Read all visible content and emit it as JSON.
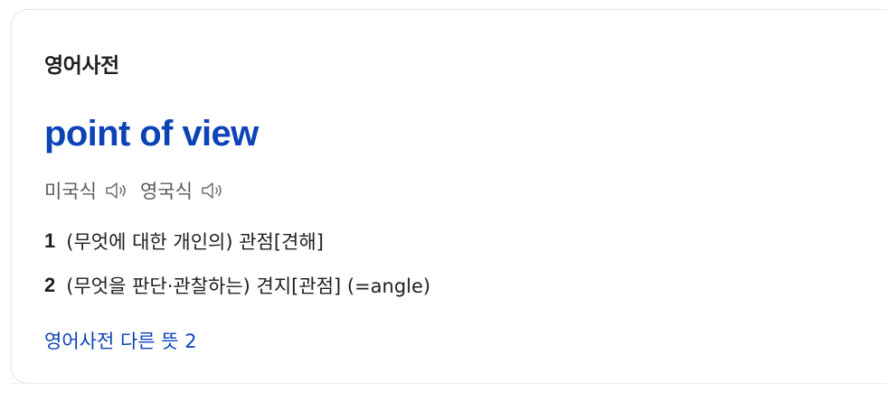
{
  "section": {
    "title": "영어사전"
  },
  "entry": {
    "headword": "point of view",
    "pronunciations": [
      {
        "label": "미국식",
        "icon": "speaker-icon"
      },
      {
        "label": "영국식",
        "icon": "speaker-icon"
      }
    ],
    "meanings": [
      {
        "number": "1",
        "text": "(무엇에 대한 개인의) 관점[견해]"
      },
      {
        "number": "2",
        "text": "(무엇을 판단·관찰하는) 견지[관점] (=angle)"
      }
    ],
    "more_link": "영어사전 다른 뜻 2"
  },
  "colors": {
    "link": "#0c43b7",
    "text": "#1f1f1f",
    "muted": "#555a60",
    "border": "#e3e6ea"
  }
}
